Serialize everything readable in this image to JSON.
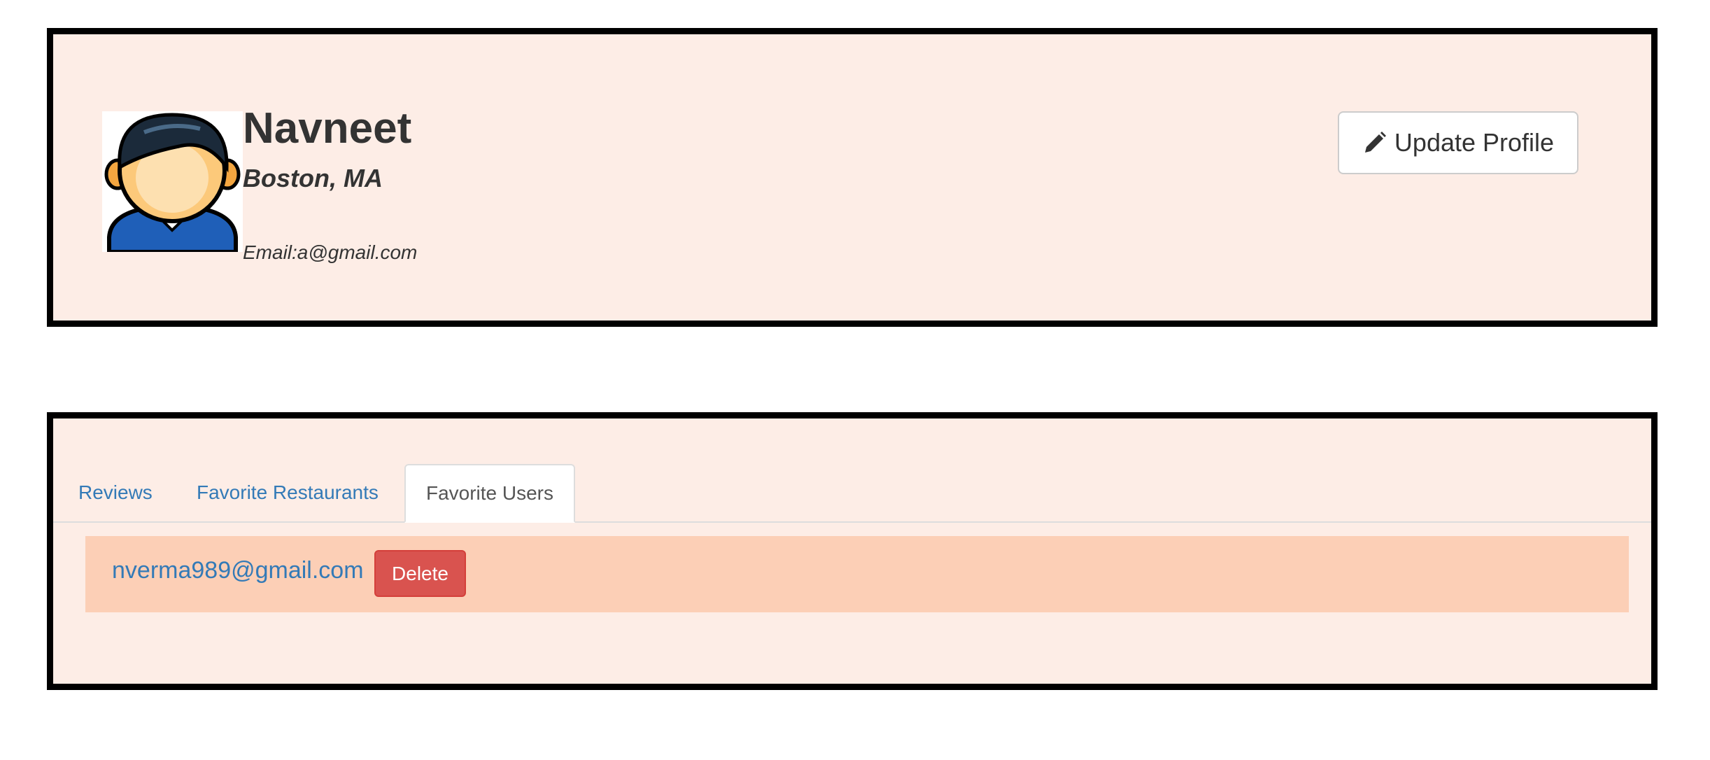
{
  "profile": {
    "name": "Navneet",
    "location": "Boston, MA",
    "email": "Email:a@gmail.com",
    "avatar_icon": "user-avatar-icon",
    "update_button": {
      "label": "Update Profile",
      "icon": "pencil-icon"
    }
  },
  "tabs": [
    {
      "label": "Reviews",
      "active": false
    },
    {
      "label": "Favorite Restaurants",
      "active": false
    },
    {
      "label": "Favorite Users",
      "active": true
    }
  ],
  "favorite_users": [
    {
      "email": "nverma989@gmail.com",
      "delete_label": "Delete"
    }
  ],
  "colors": {
    "panel_bg": "#fdede6",
    "row_bg": "#fccfb6",
    "link": "#337ab7",
    "danger": "#d9534f"
  }
}
